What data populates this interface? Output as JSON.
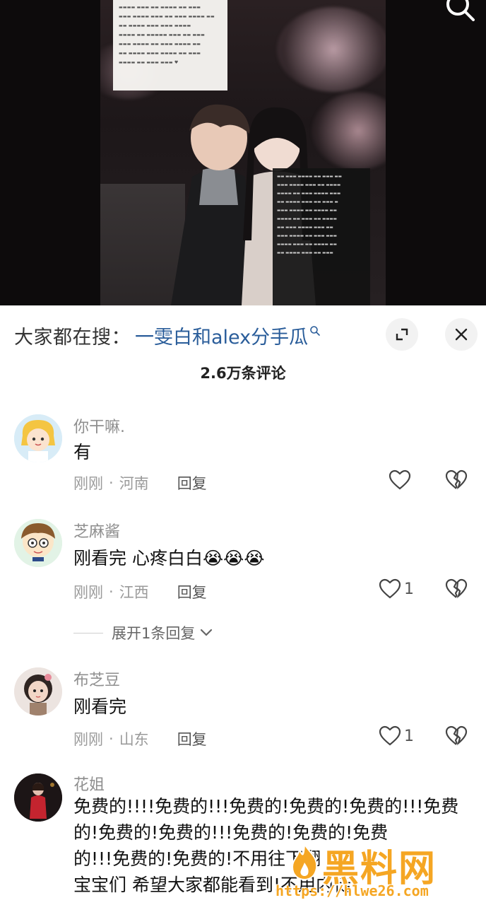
{
  "search": {
    "prefix": "大家都在搜：",
    "term": "一雯白和alex分手瓜"
  },
  "comments_header": {
    "count": "2.6万条评论"
  },
  "comments": [
    {
      "name": "你干嘛.",
      "text": "有",
      "time": "刚刚",
      "location": "河南",
      "reply": "回复",
      "likes": ""
    },
    {
      "name": "芝麻酱",
      "text": "刚看完 心疼白白😭😭😭",
      "time": "刚刚",
      "location": "江西",
      "reply": "回复",
      "likes": "1",
      "expand": "展开1条回复"
    },
    {
      "name": "布芝豆",
      "text": "刚看完",
      "time": "刚刚",
      "location": "山东",
      "reply": "回复",
      "likes": "1"
    },
    {
      "name": "花姐",
      "lines": [
        "免费的!!!!免费的!!!免费的!免费的!免费的!!!免费",
        "的!免费的!免费的!!!免费的!免费的!免费",
        "的!!!免费的!免费的!不用往下翻",
        "宝宝们 希望大家都能看到!不用内徒"
      ]
    }
  ],
  "watermark": {
    "title": "黑料网",
    "url": "https://hlwe26.com"
  },
  "colors": {
    "search_term": "#2a5d9a",
    "meta_gray": "#9a9a9a",
    "watermark": "#f5a623"
  },
  "icons": [
    "search-icon",
    "expand-icon",
    "close-icon",
    "heart-icon",
    "dislike-icon",
    "chevron-down-icon"
  ]
}
